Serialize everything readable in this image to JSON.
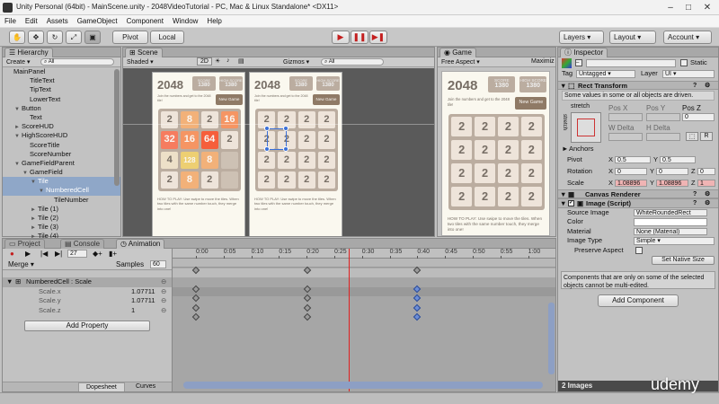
{
  "window": {
    "title": "Unity Personal (64bit) - MainScene.unity - 2048VideoTutorial - PC, Mac & Linux Standalone* <DX11>",
    "minimize": "–",
    "maximize": "□",
    "close": "✕"
  },
  "menu": [
    "File",
    "Edit",
    "Assets",
    "GameObject",
    "Component",
    "Window",
    "Help"
  ],
  "toolbar": {
    "pivot": "Pivot",
    "local": "Local",
    "layers": "Layers",
    "layout": "Layout",
    "account": "Account"
  },
  "hierarchy": {
    "tab": "Hierarchy",
    "create": "Create",
    "search": "All",
    "items": [
      {
        "label": "MainPanel",
        "d": 0,
        "a": ""
      },
      {
        "label": "TitleText",
        "d": 2,
        "a": ""
      },
      {
        "label": "TipText",
        "d": 2,
        "a": ""
      },
      {
        "label": "LowerText",
        "d": 2,
        "a": ""
      },
      {
        "label": "Button",
        "d": 1,
        "a": "▼"
      },
      {
        "label": "Text",
        "d": 2,
        "a": ""
      },
      {
        "label": "ScoreHUD",
        "d": 1,
        "a": "►"
      },
      {
        "label": "HighScoreHUD",
        "d": 1,
        "a": "▼"
      },
      {
        "label": "ScoreTitle",
        "d": 2,
        "a": ""
      },
      {
        "label": "ScoreNumber",
        "d": 2,
        "a": ""
      },
      {
        "label": "GameFieldParent",
        "d": 1,
        "a": "▼"
      },
      {
        "label": "GameField",
        "d": 2,
        "a": "▼"
      },
      {
        "label": "Tile",
        "d": 3,
        "a": "▼",
        "sel": true
      },
      {
        "label": "NumberedCell",
        "d": 4,
        "a": "▼",
        "sel": true
      },
      {
        "label": "TileNumber",
        "d": 5,
        "a": ""
      },
      {
        "label": "Tile (1)",
        "d": 3,
        "a": "►"
      },
      {
        "label": "Tile (2)",
        "d": 3,
        "a": "►"
      },
      {
        "label": "Tile (3)",
        "d": 3,
        "a": "►"
      },
      {
        "label": "Tile (4)",
        "d": 3,
        "a": "►"
      },
      {
        "label": "Tile (5)",
        "d": 3,
        "a": "►"
      }
    ]
  },
  "scene": {
    "tab": "Scene",
    "shaded": "Shaded",
    "twod": "2D",
    "gizmos": "Gizmos",
    "search": "All"
  },
  "game_view": {
    "tab": "Game",
    "aspect": "Free Aspect",
    "maximize": "Maximiz"
  },
  "game": {
    "title": "2048",
    "score_label": "SCORE",
    "score": "1380",
    "best_label": "HIGH SCORE",
    "best": "1380",
    "new_game": "New Game",
    "tip": "Join the numbers and get to the 2048 tile!",
    "howto": "HOW TO PLAY: Use swipe to move the tiles. When two tiles with the same number touch, they merge into one!",
    "board1": [
      "2",
      "8",
      "2",
      "16",
      "32",
      "16",
      "64",
      "2",
      "4",
      "128",
      "8",
      "",
      "2",
      "8",
      "2",
      ""
    ],
    "board2": [
      "2",
      "2",
      "2",
      "2",
      "2",
      "2",
      "2",
      "2",
      "2",
      "2",
      "2",
      "2",
      "2",
      "2",
      "2",
      "2"
    ]
  },
  "bottom": {
    "tabs": [
      "Project",
      "Console",
      "Animation"
    ],
    "frame": "27",
    "clip": "Merge",
    "samples_label": "Samples",
    "samples": "60",
    "ruler": [
      "0:00",
      "0:05",
      "0:10",
      "0:15",
      "0:20",
      "0:25",
      "0:30",
      "0:35",
      "0:40",
      "0:45",
      "0:50",
      "0:55",
      "1:00"
    ],
    "props": [
      {
        "label": "NumberedCell : Scale",
        "value": ""
      },
      {
        "label": "Scale.x",
        "value": "1.07711"
      },
      {
        "label": "Scale.y",
        "value": "1.07711"
      },
      {
        "label": "Scale.z",
        "value": "1"
      }
    ],
    "add_property": "Add Property",
    "dopesheet": "Dopesheet",
    "curves": "Curves"
  },
  "inspector": {
    "tab": "Inspector",
    "static": "Static",
    "tag_label": "Tag",
    "tag": "Untagged",
    "layer_label": "Layer",
    "layer": "UI",
    "rect_transform": "Rect Transform",
    "rect_note": "Some values in some or all objects are driven.",
    "stretch": "stretch",
    "pos_x": "Pos X",
    "pos_y": "Pos Y",
    "pos_z": "Pos Z",
    "pos_z_val": "0",
    "w_delta": "W Delta",
    "h_delta": "H Delta",
    "r_btn": "R",
    "anchors": "Anchors",
    "pivot_label": "Pivot",
    "pivot_x": "0.5",
    "pivot_y": "0.5",
    "x": "X",
    "y": "Y",
    "z": "Z",
    "rotation_label": "Rotation",
    "rot_x": "0",
    "rot_y": "0",
    "rot_z": "0",
    "scale_label": "Scale",
    "scale_x": "1.08896",
    "scale_y": "1.08896",
    "scale_z": "1",
    "canvas_renderer": "Canvas Renderer",
    "image_script": "Image (Script)",
    "source_image_label": "Source Image",
    "source_image": "WhiteRoundedRect",
    "color_label": "Color",
    "material_label": "Material",
    "material": "None (Material)",
    "image_type_label": "Image Type",
    "image_type": "Simple",
    "preserve_label": "Preserve Aspect",
    "native_size": "Set Native Size",
    "multi_note": "Components that are only on some of the selected objects cannot be multi-edited.",
    "add_component": "Add Component",
    "footer": "2 Images"
  },
  "watermark": "udemy",
  "colors": {
    "accent": "#5a7fc4",
    "record": "#c41e1e",
    "scrubber": "#e02020"
  }
}
